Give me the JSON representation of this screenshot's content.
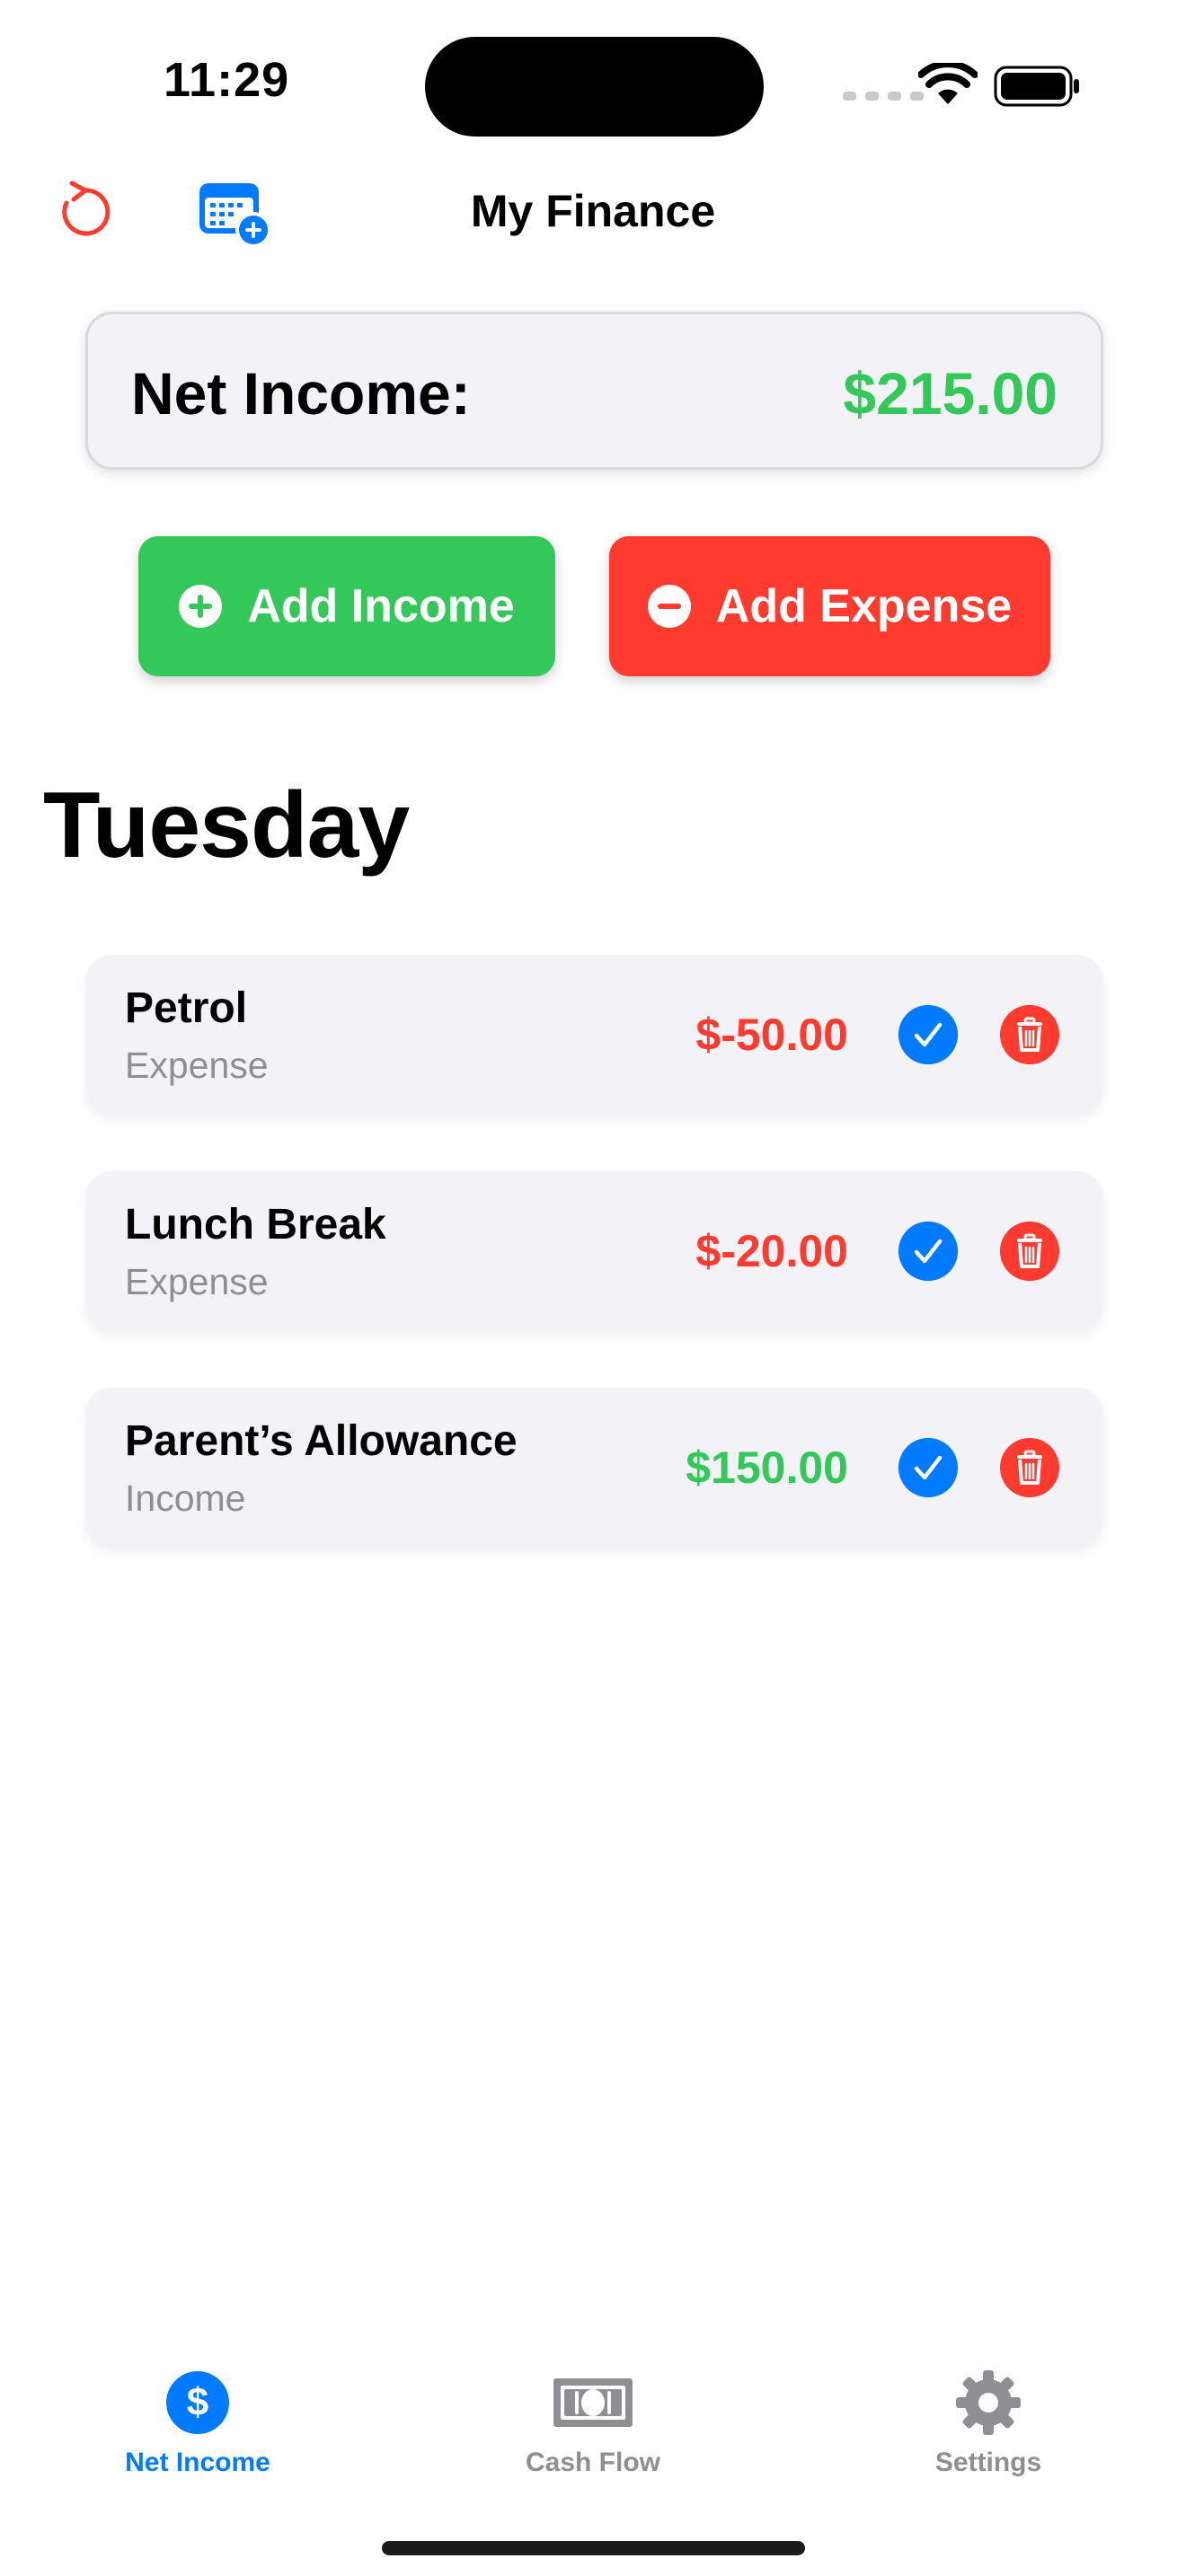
{
  "status_bar": {
    "time": "11:29"
  },
  "nav": {
    "title": "My Finance",
    "left_icon": "reset-icon",
    "calendar_icon": "calendar-add-icon"
  },
  "net_income": {
    "label": "Net Income:",
    "value": "$215.00"
  },
  "actions": {
    "add_income_label": "Add Income",
    "add_expense_label": "Add Expense"
  },
  "day": {
    "title": "Tuesday"
  },
  "transactions": [
    {
      "name": "Petrol",
      "type": "Expense",
      "amount": "$-50.00",
      "amount_color": "#ff3b30"
    },
    {
      "name": "Lunch Break",
      "type": "Expense",
      "amount": "$-20.00",
      "amount_color": "#ff3b30"
    },
    {
      "name": "Parent’s Allowance",
      "type": "Income",
      "amount": "$150.00",
      "amount_color": "#34c759"
    }
  ],
  "tabs": [
    {
      "label": "Net Income",
      "icon": "dollar-circle-icon",
      "active": true
    },
    {
      "label": "Cash Flow",
      "icon": "banknote-icon",
      "active": false
    },
    {
      "label": "Settings",
      "icon": "gear-icon",
      "active": false
    }
  ],
  "colors": {
    "income": "#34c759",
    "expense": "#ff3b30",
    "accent": "#007aff",
    "card_bg": "#f2f2f7",
    "secondary_text": "#8e8e93"
  }
}
